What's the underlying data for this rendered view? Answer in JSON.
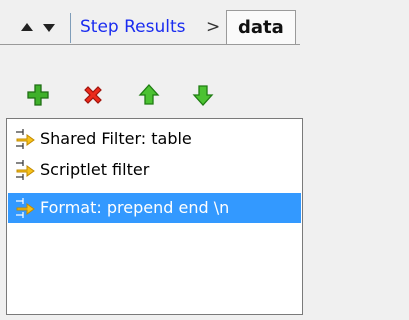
{
  "breadcrumb": {
    "parent": "Step Results",
    "separator": ">",
    "current": "data"
  },
  "toolbar": {
    "add": "plus-icon",
    "remove": "delete-icon",
    "move_up": "arrow-up-icon",
    "move_down": "arrow-down-icon"
  },
  "filters": [
    {
      "label": "Shared Filter: table",
      "selected": false
    },
    {
      "label": "Scriptlet filter",
      "selected": false
    },
    {
      "label": "Format: prepend end \\n",
      "selected": true
    }
  ],
  "colors": {
    "link": "#1a2cf0",
    "selection": "#3399ff",
    "add_green": "#2e9b1f",
    "remove_red": "#e0241a"
  }
}
